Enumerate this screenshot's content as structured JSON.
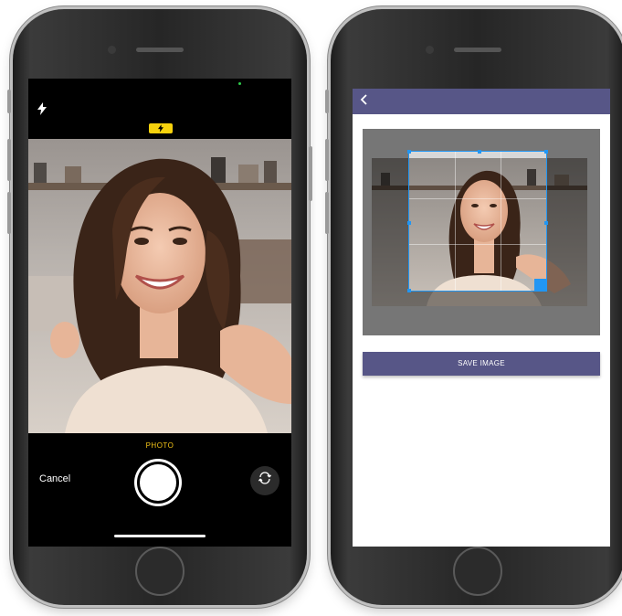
{
  "camera_screen": {
    "flash_icon": "flash-icon",
    "flash_badge_icon": "flash-icon",
    "mode_label": "PHOTO",
    "cancel_label": "Cancel",
    "flip_icon": "camera-flip-icon"
  },
  "crop_screen": {
    "back_icon": "back-chevron-icon",
    "save_button_label": "SAVE IMAGE",
    "accent_color": "#575687",
    "crop_handle_color": "#2196f3"
  }
}
